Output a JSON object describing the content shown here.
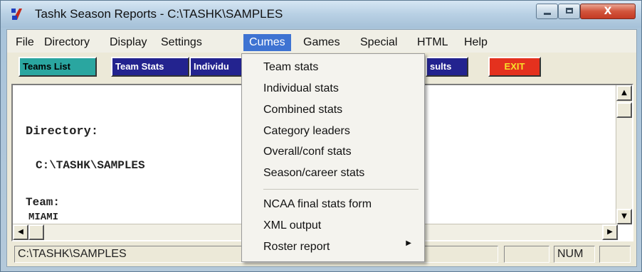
{
  "window": {
    "title": "Tashk Season Reports - C:\\TASHK\\SAMPLES",
    "close_label": "X"
  },
  "menubar": {
    "items": [
      {
        "label": "File"
      },
      {
        "label": "Directory"
      },
      {
        "label": "Display"
      },
      {
        "label": "Settings"
      },
      {
        "label": "Cumes",
        "active": true
      },
      {
        "label": "Games"
      },
      {
        "label": "Special"
      },
      {
        "label": "HTML"
      },
      {
        "label": "Help"
      }
    ]
  },
  "toolbar": {
    "buttons": [
      {
        "label": "Teams List",
        "color": "#2aa6a0"
      },
      {
        "label": "Team Stats",
        "color": "#23238f"
      },
      {
        "label": "Individu",
        "color": "#23238f"
      },
      {
        "label": "sults",
        "color": "#23238f"
      },
      {
        "label": "EXIT",
        "color": "#e4311e"
      }
    ]
  },
  "content": {
    "directory_label": "Directory:",
    "directory_value": "C:\\TASHK\\SAMPLES",
    "team_label": "Team:",
    "team_value": "MIAMI"
  },
  "cumes_menu": {
    "items": [
      {
        "label": "Team stats"
      },
      {
        "label": "Individual stats"
      },
      {
        "label": "Combined stats"
      },
      {
        "label": "Category leaders"
      },
      {
        "label": "Overall/conf stats"
      },
      {
        "label": "Season/career stats"
      },
      {
        "label": "NCAA final stats form"
      },
      {
        "label": "XML output"
      },
      {
        "label": "Roster report",
        "has_submenu": true
      }
    ]
  },
  "statusbar": {
    "path": "C:\\TASHK\\SAMPLES",
    "num": "NUM"
  }
}
